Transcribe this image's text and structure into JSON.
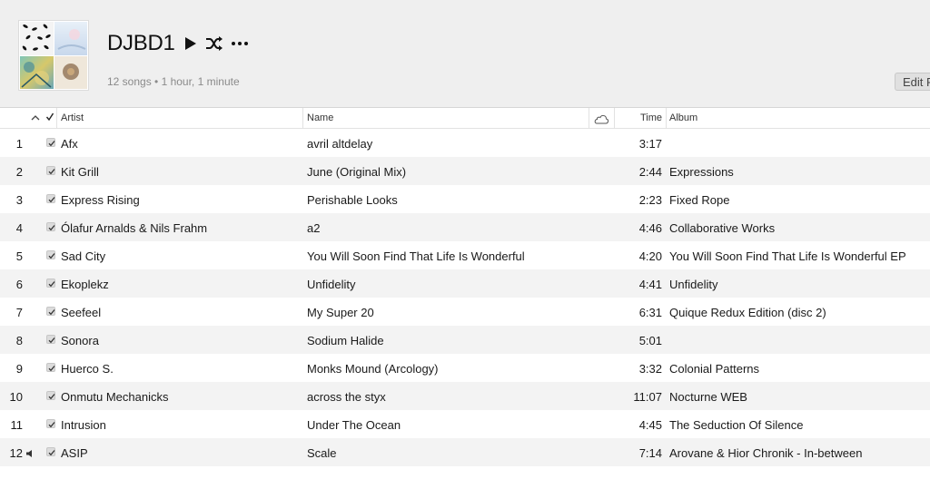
{
  "playlist": {
    "title": "DJBD1",
    "summary": "12 songs • 1 hour, 1 minute",
    "edit_label": "Edit Playlist"
  },
  "columns": {
    "artist": "Artist",
    "name": "Name",
    "time": "Time",
    "album": "Album"
  },
  "icons": {
    "play": "play-icon",
    "shuffle": "shuffle-icon",
    "more": "ellipsis-icon",
    "sort": "chevron-up-icon",
    "check": "checkmark-icon",
    "cloud": "cloud-icon",
    "now_playing": "speaker-icon"
  },
  "tracks": [
    {
      "num": "1",
      "artist": "Afx",
      "name": "avril altdelay",
      "time": "3:17",
      "album": ""
    },
    {
      "num": "2",
      "artist": "Kit Grill",
      "name": "June (Original Mix)",
      "time": "2:44",
      "album": "Expressions"
    },
    {
      "num": "3",
      "artist": "Express Rising",
      "name": "Perishable Looks",
      "time": "2:23",
      "album": "Fixed Rope"
    },
    {
      "num": "4",
      "artist": "Ólafur Arnalds & Nils Frahm",
      "name": "a2",
      "time": "4:46",
      "album": "Collaborative Works"
    },
    {
      "num": "5",
      "artist": "Sad City",
      "name": "You Will Soon Find That Life Is Wonderful",
      "time": "4:20",
      "album": "You Will Soon Find That Life Is Wonderful EP"
    },
    {
      "num": "6",
      "artist": "Ekoplekz",
      "name": "Unfidelity",
      "time": "4:41",
      "album": "Unfidelity"
    },
    {
      "num": "7",
      "artist": "Seefeel",
      "name": "My Super 20",
      "time": "6:31",
      "album": "Quique Redux Edition (disc 2)"
    },
    {
      "num": "8",
      "artist": "Sonora",
      "name": "Sodium Halide",
      "time": "5:01",
      "album": ""
    },
    {
      "num": "9",
      "artist": "Huerco S.",
      "name": "Monks Mound (Arcology)",
      "time": "3:32",
      "album": "Colonial Patterns"
    },
    {
      "num": "10",
      "artist": "Onmutu Mechanicks",
      "name": "across the styx",
      "time": "11:07",
      "album": "Nocturne WEB"
    },
    {
      "num": "11",
      "artist": "Intrusion",
      "name": "Under The Ocean",
      "time": "4:45",
      "album": "The Seduction Of Silence"
    },
    {
      "num": "12",
      "artist": "ASIP",
      "name": "Scale",
      "time": "7:14",
      "album": "Arovane & Hior Chronik - In-between",
      "playing": true
    }
  ]
}
